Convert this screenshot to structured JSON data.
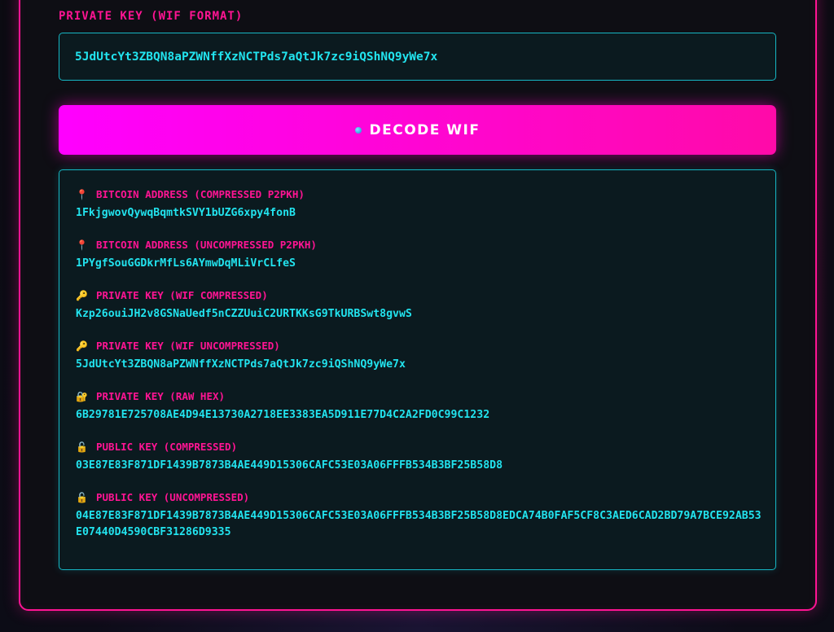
{
  "form": {
    "label": "PRIVATE KEY (WIF FORMAT)",
    "wif_value": "5JdUtcYt3ZBQN8aPZWNffXzNCTPds7aQtJk7zc9iQShNQ9yWe7x",
    "decode_label": "DECODE WIF"
  },
  "results": [
    {
      "icon": "pin-icon",
      "glyph": "📍",
      "label": "BITCOIN ADDRESS (COMPRESSED P2PKH)",
      "value": "1FkjgwovQywqBqmtkSVY1bUZG6xpy4fonB"
    },
    {
      "icon": "pin-icon",
      "glyph": "📍",
      "label": "BITCOIN ADDRESS (UNCOMPRESSED P2PKH)",
      "value": "1PYgfSouGGDkrMfLs6AYmwDqMLiVrCLfeS"
    },
    {
      "icon": "key-icon",
      "glyph": "🔑",
      "label": "PRIVATE KEY (WIF COMPRESSED)",
      "value": "Kzp26ouiJH2v8GSNaUedf5nCZZUuiC2URTKKsG9TkURBSwt8gvwS"
    },
    {
      "icon": "key-icon",
      "glyph": "🔑",
      "label": "PRIVATE KEY (WIF UNCOMPRESSED)",
      "value": "5JdUtcYt3ZBQN8aPZWNffXzNCTPds7aQtJk7zc9iQShNQ9yWe7x"
    },
    {
      "icon": "lock-icon",
      "glyph": "🔐",
      "label": "PRIVATE KEY (RAW HEX)",
      "value": "6B29781E725708AE4D94E13730A2718EE3383EA5D911E77D4C2A2FD0C99C1232"
    },
    {
      "icon": "unlock-icon",
      "glyph": "🔓",
      "label": "PUBLIC KEY (COMPRESSED)",
      "value": "03E87E83F871DF1439B7873B4AE449D15306CAFC53E03A06FFFB534B3BF25B58D8"
    },
    {
      "icon": "unlock-icon",
      "glyph": "🔓",
      "label": "PUBLIC KEY (UNCOMPRESSED)",
      "value": "04E87E83F871DF1439B7873B4AE449D15306CAFC53E03A06FFFB534B3BF25B58D8EDCA74B0FAF5CF8C3AED6CAD2BD79A7BCE92AB53E07440D4590CBF31286D9335"
    }
  ],
  "colors": {
    "accent_pink": "#ff1493",
    "accent_cyan": "#22e3ee",
    "button_gradient_start": "#ff00ff",
    "button_gradient_end": "#ff0aa8"
  }
}
